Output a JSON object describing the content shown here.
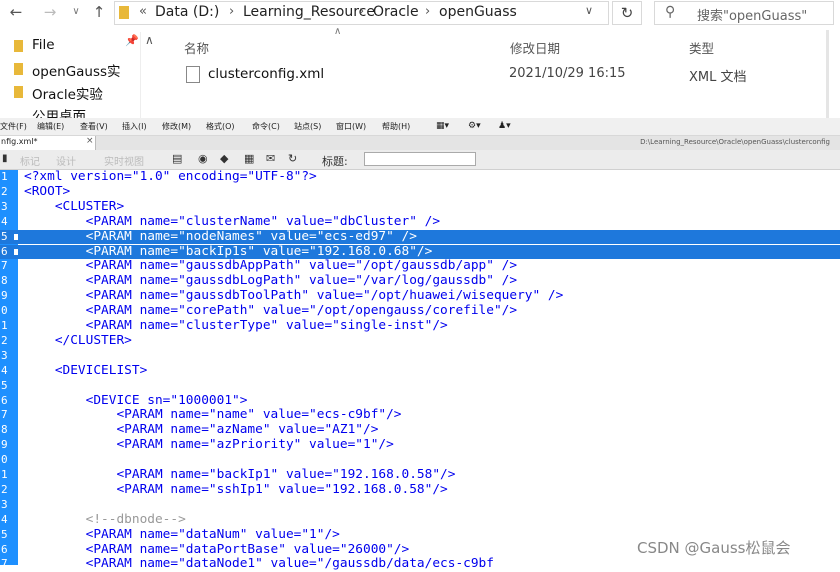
{
  "explorer": {
    "address": [
      "Data (D:)",
      "Learning_Resource",
      "Oracle",
      "openGuass"
    ],
    "search_placeholder": "搜索\"openGuass\"",
    "sidebar": [
      "File",
      "openGauss实",
      "Oracle实验",
      "公用桌面"
    ],
    "columns": {
      "name": "名称",
      "date": "修改日期",
      "type": "类型"
    },
    "file": {
      "name": "clusterconfig.xml",
      "date": "2021/10/29 16:15",
      "type": "XML 文档"
    }
  },
  "editor": {
    "menus": [
      "文件(F)",
      "编辑(E)",
      "查看(V)",
      "插入(I)",
      "修改(M)",
      "格式(O)",
      "命令(C)",
      "站点(S)",
      "窗口(W)",
      "帮助(H)"
    ],
    "tab": "nfig.xml*",
    "path": "D:\\Learning_Resource\\Oracle\\openGuass\\clusterconfig",
    "toolbar": {
      "btn1": "标记",
      "btn2": "设计",
      "btn3": "实时视图",
      "title_label": "标题:"
    },
    "lines": [
      {
        "n": "1",
        "t": "<?xml version=\"1.0\" encoding=\"UTF-8\"?>"
      },
      {
        "n": "2",
        "t": "<ROOT>"
      },
      {
        "n": "3",
        "t": "    <CLUSTER>"
      },
      {
        "n": "4",
        "t": "        <PARAM name=\"clusterName\" value=\"dbCluster\" />"
      },
      {
        "n": "5",
        "t": "        <PARAM name=\"nodeNames\" value=\"ecs-ed97\" />",
        "sel": true
      },
      {
        "n": "6",
        "t": "        <PARAM name=\"backIp1s\" value=\"192.168.0.68\"/>",
        "sel": true
      },
      {
        "n": "7",
        "t": "        <PARAM name=\"gaussdbAppPath\" value=\"/opt/gaussdb/app\" />"
      },
      {
        "n": "8",
        "t": "        <PARAM name=\"gaussdbLogPath\" value=\"/var/log/gaussdb\" />"
      },
      {
        "n": "9",
        "t": "        <PARAM name=\"gaussdbToolPath\" value=\"/opt/huawei/wisequery\" />"
      },
      {
        "n": "0",
        "t": "        <PARAM name=\"corePath\" value=\"/opt/opengauss/corefile\"/>"
      },
      {
        "n": "1",
        "t": "        <PARAM name=\"clusterType\" value=\"single-inst\"/>"
      },
      {
        "n": "2",
        "t": "    </CLUSTER>"
      },
      {
        "n": "3",
        "t": ""
      },
      {
        "n": "4",
        "t": "    <DEVICELIST>"
      },
      {
        "n": "5",
        "t": ""
      },
      {
        "n": "6",
        "t": "        <DEVICE sn=\"1000001\">"
      },
      {
        "n": "7",
        "t": "            <PARAM name=\"name\" value=\"ecs-c9bf\"/>"
      },
      {
        "n": "8",
        "t": "            <PARAM name=\"azName\" value=\"AZ1\"/>"
      },
      {
        "n": "9",
        "t": "            <PARAM name=\"azPriority\" value=\"1\"/>"
      },
      {
        "n": "0",
        "t": ""
      },
      {
        "n": "1",
        "t": "            <PARAM name=\"backIp1\" value=\"192.168.0.58\"/>"
      },
      {
        "n": "2",
        "t": "            <PARAM name=\"sshIp1\" value=\"192.168.0.58\"/>"
      },
      {
        "n": "3",
        "t": ""
      },
      {
        "n": "4",
        "t": "        <!--dbnode-->",
        "comment": true
      },
      {
        "n": "5",
        "t": "        <PARAM name=\"dataNum\" value=\"1\"/>"
      },
      {
        "n": "6",
        "t": "        <PARAM name=\"dataPortBase\" value=\"26000\"/>"
      },
      {
        "n": "7",
        "t": "        <PARAM name=\"dataNode1\" value=\"/gaussdb/data/ecs-c9bf"
      }
    ]
  },
  "watermark": "CSDN @Gauss松鼠会"
}
